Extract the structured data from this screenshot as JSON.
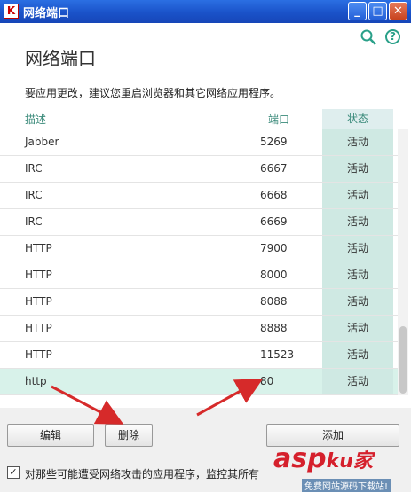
{
  "window": {
    "title": "网络端口"
  },
  "header": {
    "page_title": "网络端口",
    "notice": "要应用更改，建议您重启浏览器和其它网络应用程序。"
  },
  "table": {
    "columns": [
      "描述",
      "端口",
      "状态"
    ],
    "rows": [
      {
        "desc": "Jabber",
        "port": "5269",
        "status": "活动"
      },
      {
        "desc": "IRC",
        "port": "6667",
        "status": "活动"
      },
      {
        "desc": "IRC",
        "port": "6668",
        "status": "活动"
      },
      {
        "desc": "IRC",
        "port": "6669",
        "status": "活动"
      },
      {
        "desc": "HTTP",
        "port": "7900",
        "status": "活动"
      },
      {
        "desc": "HTTP",
        "port": "8000",
        "status": "活动"
      },
      {
        "desc": "HTTP",
        "port": "8088",
        "status": "活动"
      },
      {
        "desc": "HTTP",
        "port": "8888",
        "status": "活动"
      },
      {
        "desc": "HTTP",
        "port": "11523",
        "status": "活动"
      },
      {
        "desc": "http",
        "port": "80",
        "status": "活动",
        "selected": true
      }
    ]
  },
  "buttons": {
    "edit": "编辑",
    "delete": "删除",
    "add": "添加"
  },
  "footer": {
    "checkbox_label": "对那些可能遭受网络攻击的应用程序，监控其所有",
    "checked": true
  },
  "watermark": {
    "main": "asp",
    "main2": "ku",
    "main3": "家",
    "sub": "免费网站源码下载站!"
  },
  "colors": {
    "accent": "#2aa089",
    "status_bg": "#cfe9e3",
    "selected_row": "#d8f2ea",
    "arrow": "#d62a2a"
  }
}
